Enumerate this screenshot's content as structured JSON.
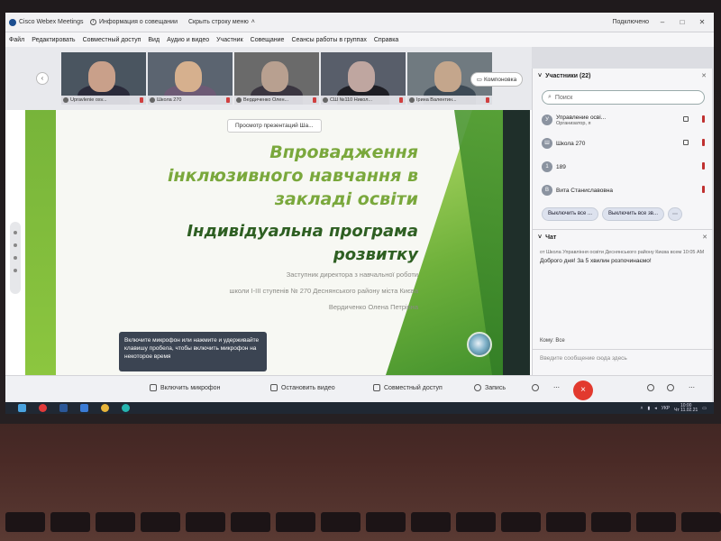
{
  "window": {
    "app_title": "Cisco Webex Meetings",
    "meeting_info": "Информация о совещании",
    "hide_menu": "Скрыть строку меню",
    "connected": "Подключено"
  },
  "menu": [
    "Файл",
    "Редактировать",
    "Совместный доступ",
    "Вид",
    "Аудио и видео",
    "Участник",
    "Совещание",
    "Сеансы работы в группах",
    "Справка"
  ],
  "video_strip": {
    "layout_button": "Компоновка",
    "thumbs": [
      {
        "name": "Upravlenie osv...",
        "face": "#c9a08a",
        "body": "#2a2a3a",
        "bg": "#4a5560"
      },
      {
        "name": "Школа 270",
        "face": "#d6b08e",
        "body": "#6d5a75",
        "bg": "#5b6470"
      },
      {
        "name": "Вердиченко Олен...",
        "face": "#b8a090",
        "body": "#3a3540",
        "bg": "#6a6a6a"
      },
      {
        "name": "СШ №110 Никол...",
        "face": "#bfa6a0",
        "body": "#1e1e24",
        "bg": "#585e6a"
      },
      {
        "name": "Ірина Валентин...",
        "face": "#c4a68c",
        "body": "#3d4a55",
        "bg": "#707a80"
      }
    ]
  },
  "presentation": {
    "sharer_banner": "Просмотр презентаций Ша...",
    "title_lines": [
      "Впровадження",
      "інклюзивного навчання в",
      "закладі освіти"
    ],
    "subtitle_lines": [
      "Індивідуальна програма",
      "розвитку"
    ],
    "meta_lines": [
      "Заступник директора з навчальної роботи",
      "школи І-ІІІ ступенів № 270 Деснянського району міста Києва",
      "Вердиченко Олена Петрівна"
    ],
    "tooltip": "Включите микрофон или нажмите и удерживайте клавишу пробела, чтобы включить микрофон на некоторое время"
  },
  "controls": {
    "mic": "Включить микрофон",
    "video": "Остановить видео",
    "share": "Совместный доступ",
    "record": "Запись",
    "end": "×"
  },
  "participants": {
    "header": "Участники (22)",
    "search_placeholder": "Поиск",
    "list": [
      {
        "initial": "У",
        "name": "Управление осві...",
        "role": "Организатор, я"
      },
      {
        "initial": "Ш",
        "name": "Школа 270",
        "role": ""
      },
      {
        "initial": "1",
        "name": "189",
        "role": ""
      },
      {
        "initial": "В",
        "name": "Вита Станиславовна",
        "role": ""
      }
    ],
    "unmute_all": "Выключить все ...",
    "mute_all": "Выключить все зв...",
    "more": "⋯"
  },
  "chat": {
    "header": "Чат",
    "msg_meta": "от Школа Управління освіти Деснянського району Києва всем 10:05 AM",
    "msg_text": "Доброго дня! За 5 хвилин розпочинаємо!",
    "to_label": "Кому:",
    "to_value": "Все",
    "input_placeholder": "Введите сообщение сюда здесь"
  },
  "taskbar": {
    "lang": "УКР",
    "time": "10:00",
    "date": "Чт 11.02.21"
  },
  "colors": {
    "accent_green": "#7aa83c",
    "dark_green": "#2e5f22",
    "end_red": "#e23a2e"
  }
}
